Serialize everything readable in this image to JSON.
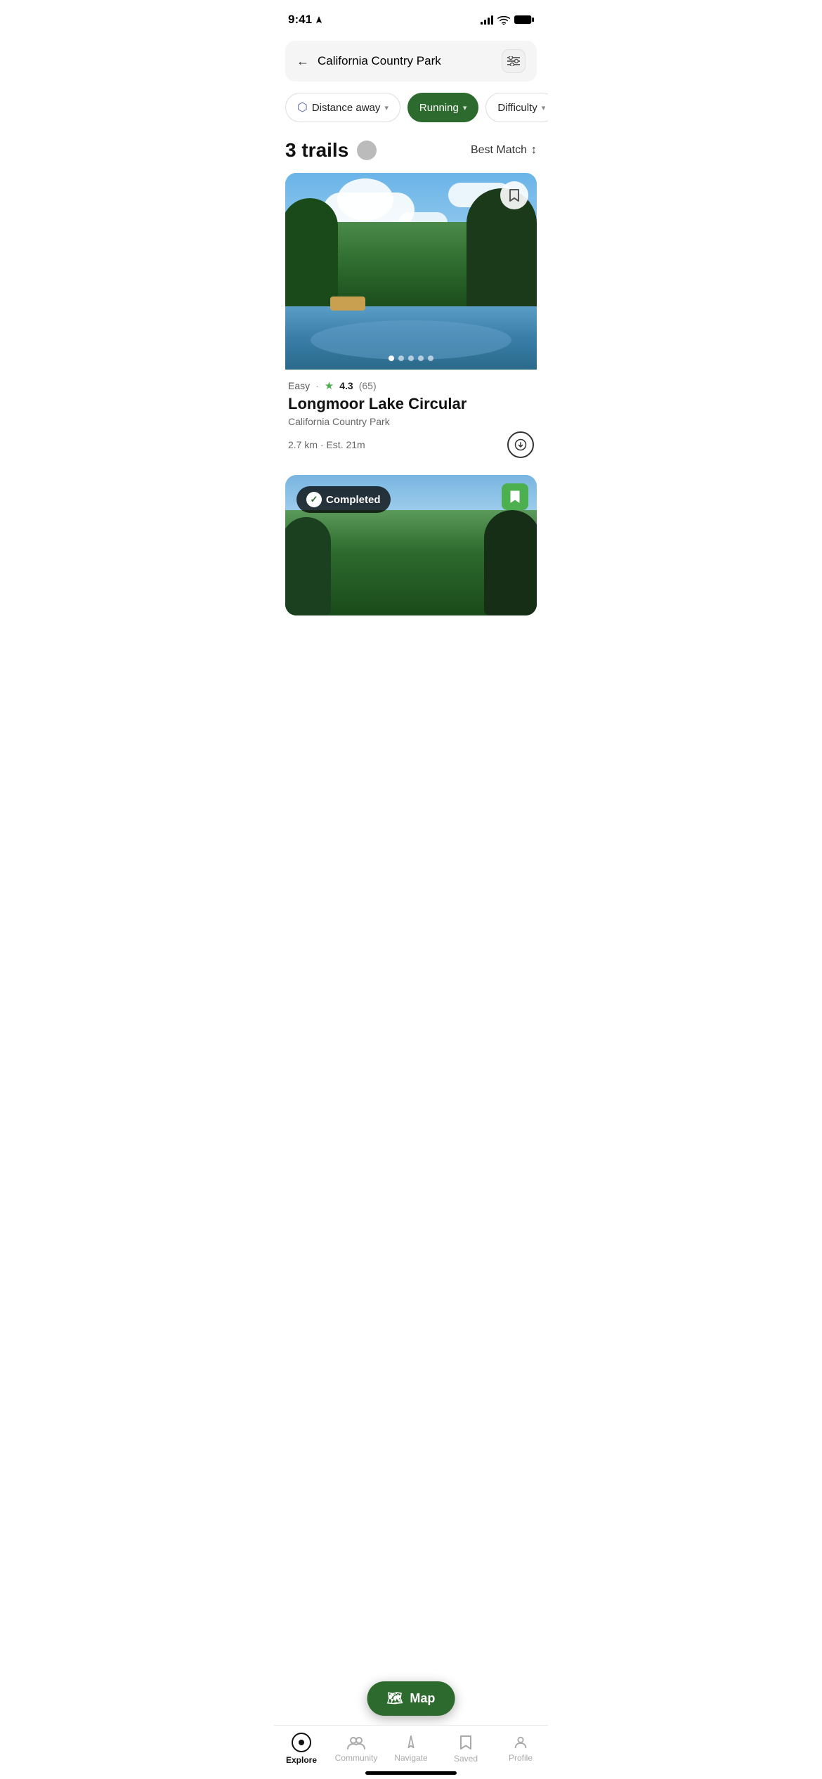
{
  "statusBar": {
    "time": "9:41",
    "locationArrow": "▶"
  },
  "searchBar": {
    "query": "California Country Park",
    "backLabel": "←",
    "filterIcon": "⊟"
  },
  "filters": [
    {
      "id": "distance",
      "label": "Distance away",
      "icon": "🛡",
      "active": false
    },
    {
      "id": "running",
      "label": "Running",
      "icon": "",
      "active": true
    },
    {
      "id": "difficulty",
      "label": "Difficulty",
      "icon": "",
      "active": false
    }
  ],
  "trailsHeader": {
    "count": "3 trails",
    "sortLabel": "Best Match",
    "sortIcon": "↕"
  },
  "trail1": {
    "difficulty": "Easy",
    "ratingValue": "4.3",
    "ratingCount": "(65)",
    "name": "Longmoor Lake Circular",
    "location": "California Country Park",
    "distance": "2.7 km",
    "duration": "Est. 21m",
    "dots": [
      true,
      false,
      false,
      false,
      false
    ]
  },
  "trail2": {
    "completedLabel": "Completed"
  },
  "mapButton": {
    "label": "Map",
    "icon": "🗺"
  },
  "bottomNav": [
    {
      "id": "explore",
      "label": "Explore",
      "active": true
    },
    {
      "id": "community",
      "label": "Community",
      "active": false
    },
    {
      "id": "navigate",
      "label": "Navigate",
      "active": false
    },
    {
      "id": "saved",
      "label": "Saved",
      "active": false
    },
    {
      "id": "profile",
      "label": "Profile",
      "active": false
    }
  ]
}
